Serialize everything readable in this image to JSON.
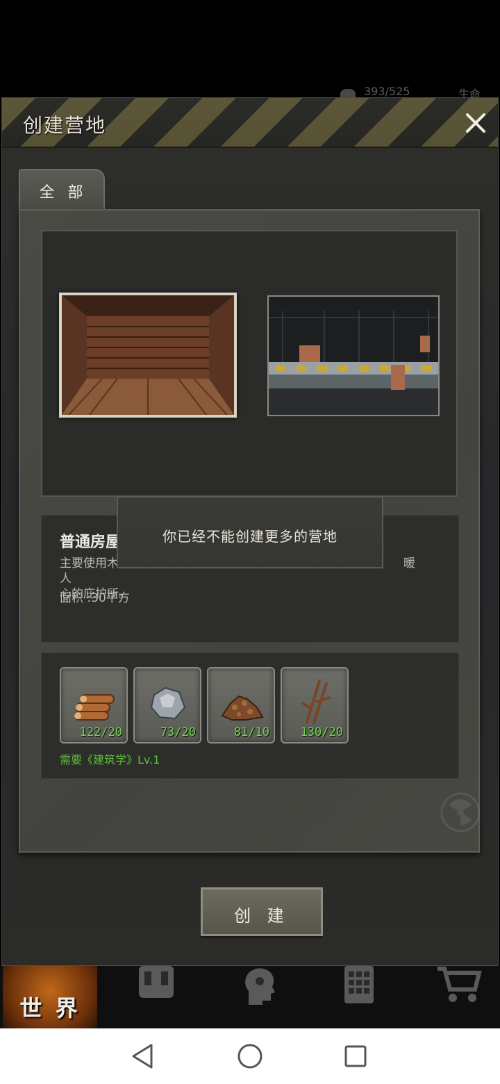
{
  "status_bar": {
    "hp_text": "393/525",
    "life_text": "生命"
  },
  "dialog": {
    "title": "创建营地",
    "close_icon": "close-x-icon",
    "tabs": [
      {
        "label": "全 部",
        "selected": true
      }
    ]
  },
  "camps": [
    {
      "name": "普通房屋",
      "image": "wooden-room",
      "selected": true
    },
    {
      "name": "",
      "image": "fenced-yard",
      "selected": false
    }
  ],
  "selected_camp": {
    "name": "普通房屋",
    "description_line1": "主要使用木",
    "description_line1_end": "暖人",
    "description_line2": "心的庇护所。",
    "area": "面积 :30平方"
  },
  "requirements": {
    "items": [
      {
        "icon": "wood-logs-icon",
        "count": "122/20"
      },
      {
        "icon": "stone-icon",
        "count": "73/20"
      },
      {
        "icon": "soil-icon",
        "count": "81/10"
      },
      {
        "icon": "branches-icon",
        "count": "130/20"
      }
    ],
    "skill": "需要《建筑学》Lv.1"
  },
  "toast": {
    "message": "你已经不能创建更多的营地"
  },
  "create_button": {
    "label": "创 建"
  },
  "game_nav": [
    {
      "label": "世 界",
      "icon": "globe-icon",
      "active": true
    },
    {
      "label": "",
      "icon": "backpack-icon",
      "active": false
    },
    {
      "label": "",
      "icon": "head-gear-icon",
      "active": false
    },
    {
      "label": "",
      "icon": "keypad-icon",
      "active": false
    },
    {
      "label": "",
      "icon": "cart-icon",
      "active": false
    }
  ],
  "system_nav": [
    "back-triangle-icon",
    "home-circle-icon",
    "recents-square-icon"
  ],
  "colors": {
    "count_text": "#6fd54c",
    "skill_text": "#5dbf3c",
    "world_tab": "#c0671a"
  }
}
